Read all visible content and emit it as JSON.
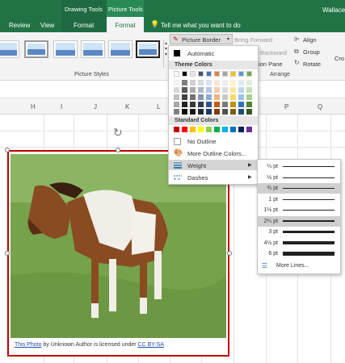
{
  "ribbon_tabs": {
    "context_drawing": "Drawing Tools",
    "context_picture": "Picture Tools",
    "review": "Review",
    "view": "View",
    "format_drawing": "Format",
    "format_picture": "Format",
    "tell_me": "Tell me what you want to do",
    "user": "Wallace"
  },
  "ribbon": {
    "picture_border": "Picture Border",
    "bring_forward": "Bring Forward",
    "backward": "Backward",
    "selection_pane": "ion Pane",
    "align": "Align",
    "group": "Group",
    "rotate": "Rotate",
    "crop": "Cro",
    "picture_styles_label": "Picture Styles",
    "arrange_label": "Arrange"
  },
  "columns": [
    "H",
    "I",
    "J",
    "K",
    "L",
    "M",
    "N",
    "O",
    "P",
    "Q"
  ],
  "border_menu": {
    "automatic": "Automatic",
    "theme_colors_header": "Theme Colors",
    "theme_top_row": [
      "#ffffff",
      "#000000",
      "#e7e6e6",
      "#44546a",
      "#4472c4",
      "#ed7d31",
      "#a5a5a5",
      "#ffc000",
      "#5b9bd5",
      "#70ad47"
    ],
    "theme_shade_columns": [
      [
        "#f2f2f2",
        "#d9d9d9",
        "#bfbfbf",
        "#a6a6a6",
        "#808080"
      ],
      [
        "#7f7f7f",
        "#595959",
        "#3f3f3f",
        "#262626",
        "#0d0d0d"
      ],
      [
        "#d0cece",
        "#aeabab",
        "#757171",
        "#3a3838",
        "#161616"
      ],
      [
        "#d6dce4",
        "#adb9ca",
        "#8496b0",
        "#333f50",
        "#222a35"
      ],
      [
        "#d9e2f3",
        "#b4c6e7",
        "#8eaadb",
        "#2f5496",
        "#1f3864"
      ],
      [
        "#fbe5d5",
        "#f7cbac",
        "#f4b183",
        "#c55a11",
        "#833c0b"
      ],
      [
        "#ededed",
        "#dbdbdb",
        "#c9c9c9",
        "#7b7b7b",
        "#525252"
      ],
      [
        "#fff2cc",
        "#fee599",
        "#ffd965",
        "#bf9000",
        "#7f6000"
      ],
      [
        "#deebf6",
        "#bdd7ee",
        "#9cc3e5",
        "#2e75b5",
        "#1f4e79"
      ],
      [
        "#e2efd9",
        "#c5e0b3",
        "#a8d08d",
        "#538135",
        "#375623"
      ]
    ],
    "standard_colors_header": "Standard Colors",
    "standard_colors": [
      "#c00000",
      "#ff0000",
      "#ffc000",
      "#ffff00",
      "#92d050",
      "#00b050",
      "#00b0f0",
      "#0070c0",
      "#002060",
      "#7030a0"
    ],
    "no_outline": "No Outline",
    "more_outline_colors": "More Outline Colors...",
    "weight": "Weight",
    "dashes": "Dashes"
  },
  "weight_menu": {
    "items": [
      {
        "label": "¼ pt",
        "weight": 0.25,
        "selected": false
      },
      {
        "label": "½ pt",
        "weight": 0.5,
        "selected": false
      },
      {
        "label": "¾ pt",
        "weight": 0.75,
        "selected": true
      },
      {
        "label": "1 pt",
        "weight": 1,
        "selected": false
      },
      {
        "label": "1½ pt",
        "weight": 1.5,
        "selected": false
      },
      {
        "label": "2¼ pt",
        "weight": 2.25,
        "selected": true
      },
      {
        "label": "3 pt",
        "weight": 3,
        "selected": false
      },
      {
        "label": "4½ pt",
        "weight": 4.5,
        "selected": false
      },
      {
        "label": "6 pt",
        "weight": 6,
        "selected": false
      }
    ],
    "more_lines": "More Lines..."
  },
  "caption": {
    "link1": "This Photo",
    "middle": " by Unknown Author is licensed under ",
    "link2": "CC BY-SA"
  },
  "colors": {
    "excel_green": "#217346",
    "picture_border": "#c00000"
  }
}
